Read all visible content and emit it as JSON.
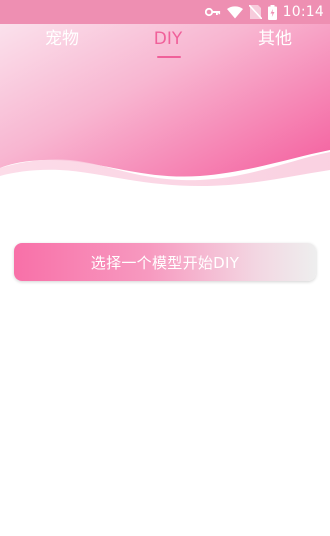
{
  "status_bar": {
    "time": "10:14",
    "icons": [
      "key-icon",
      "wifi-icon",
      "no-sim-icon",
      "battery-icon"
    ]
  },
  "tabs": [
    {
      "label": "宠物",
      "selected": false
    },
    {
      "label": "DIY",
      "selected": true
    },
    {
      "label": "其他",
      "selected": false
    }
  ],
  "main": {
    "start_button_label": "选择一个模型开始DIY"
  },
  "colors": {
    "accent": "#f0609a",
    "header_gradient_start": "#fbe6ef",
    "header_gradient_end": "#f765a3",
    "button_gradient_start": "#f870a8",
    "button_gradient_end": "#eeeeee"
  }
}
